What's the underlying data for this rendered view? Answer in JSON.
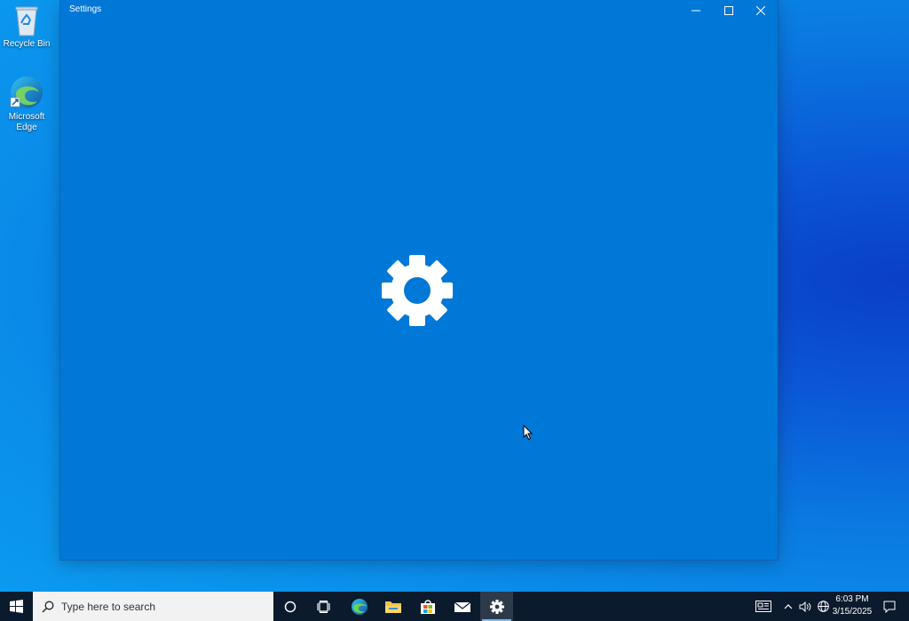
{
  "desktop": {
    "icons": [
      {
        "label": "Recycle Bin",
        "icon": "recycle-bin-icon"
      },
      {
        "label": "Microsoft Edge",
        "icon": "edge-icon"
      }
    ]
  },
  "window": {
    "title": "Settings",
    "splash_icon": "gear-icon",
    "accent": "#0078d7"
  },
  "taskbar": {
    "search_placeholder": "Type here to search",
    "apps": [
      "cortana-icon",
      "task-view-icon",
      "edge-icon",
      "file-explorer-icon",
      "store-icon",
      "mail-icon",
      "settings-icon"
    ],
    "active_app": "Settings",
    "clock_time": "6:03 PM",
    "clock_date": "3/15/2025",
    "background": "#0b1a2c"
  }
}
